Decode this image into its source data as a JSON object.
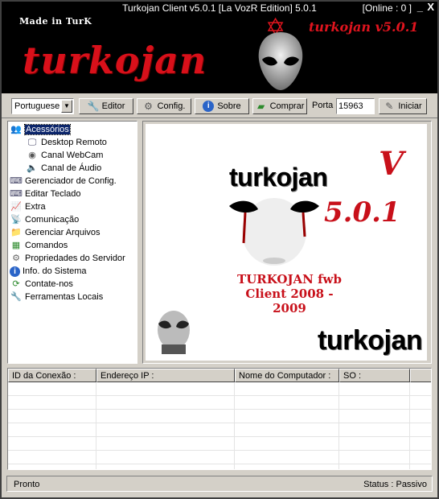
{
  "window": {
    "title": "Turkojan Client v5.0.1 [La VozR Edition] 5.0.1",
    "online": "[Online : 0 ]",
    "minimize": "_",
    "close": "X"
  },
  "header": {
    "made_in": "Made in TurK",
    "logo_big": "turkojan",
    "logo_small": "turkojan v5.0.1",
    "accent_color": "#d8101a"
  },
  "toolbar": {
    "language": "Portuguese",
    "editor_label": "Editor",
    "config_label": "Config.",
    "about_label": "Sobre",
    "buy_label": "Comprar",
    "port_label": "Porta",
    "port_value": "15963",
    "start_label": "Iniciar"
  },
  "tree": {
    "items": [
      {
        "label": "Acessórios",
        "icon": "users-icon"
      },
      {
        "label": "Desktop Remoto",
        "icon": "monitor-icon"
      },
      {
        "label": "Canal WebCam",
        "icon": "webcam-icon"
      },
      {
        "label": "Canal de Áudio",
        "icon": "speaker-icon"
      },
      {
        "label": "Gerenciador de Config.",
        "icon": "keyboard-icon"
      },
      {
        "label": "Editar Teclado",
        "icon": "keyboard-icon"
      },
      {
        "label": "Extra",
        "icon": "chart-icon"
      },
      {
        "label": "Comunicação",
        "icon": "antenna-icon"
      },
      {
        "label": "Gerenciar Arquivos",
        "icon": "folder-icon"
      },
      {
        "label": "Comandos",
        "icon": "network-icon"
      },
      {
        "label": "Propriedades do Servidor",
        "icon": "gear-icon"
      },
      {
        "label": "Info. do Sistema",
        "icon": "info-icon"
      },
      {
        "label": "Contate-nos",
        "icon": "refresh-icon"
      },
      {
        "label": "Ferramentas Locais",
        "icon": "tools-icon"
      }
    ]
  },
  "banner": {
    "title_top": "turkojan",
    "v_letter": "V",
    "version": "5.0.1",
    "line1": "TURKOJAN fwb",
    "line2": "Client  2008 - 2009",
    "title_bottom": "turkojan"
  },
  "connections": {
    "columns": [
      "ID da Conexão :",
      "Endereço IP :",
      "Nome do Computador :",
      "SO :"
    ],
    "rows": []
  },
  "status": {
    "left": "Pronto",
    "right": "Status : Passivo"
  }
}
